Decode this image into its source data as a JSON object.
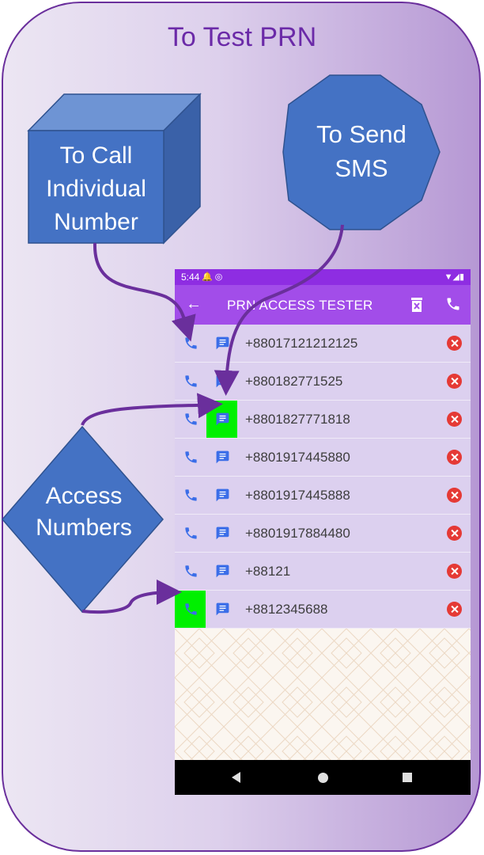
{
  "diagram": {
    "title": "To Test PRN",
    "call_label": "To Call Individual Number",
    "sms_label": "To Send SMS",
    "access_label": "Access Numbers"
  },
  "phone": {
    "status": {
      "time": "5:44"
    },
    "appbar": {
      "title": "PRN ACCESS TESTER",
      "back_icon": "arrow-back-icon",
      "delete_icon": "delete-all-icon",
      "call_icon": "phone-icon"
    },
    "rows": [
      {
        "number": "+88017121212125",
        "highlight": ""
      },
      {
        "number": "+880182771525",
        "highlight": ""
      },
      {
        "number": "+8801827771818",
        "highlight": "sms"
      },
      {
        "number": "+8801917445880",
        "highlight": ""
      },
      {
        "number": "+8801917445888",
        "highlight": ""
      },
      {
        "number": "+8801917884480",
        "highlight": ""
      },
      {
        "number": "+88121",
        "highlight": ""
      },
      {
        "number": "+8812345688",
        "highlight": "call"
      }
    ]
  },
  "colors": {
    "appbar": "#a24de9",
    "statusbar": "#8e2de2",
    "row": "#dcd0ef",
    "icon": "#3b6ee8",
    "highlight": "#00f000",
    "remove": "#e53935",
    "shape": "#4472c4",
    "arrow": "#6a2f9c"
  }
}
